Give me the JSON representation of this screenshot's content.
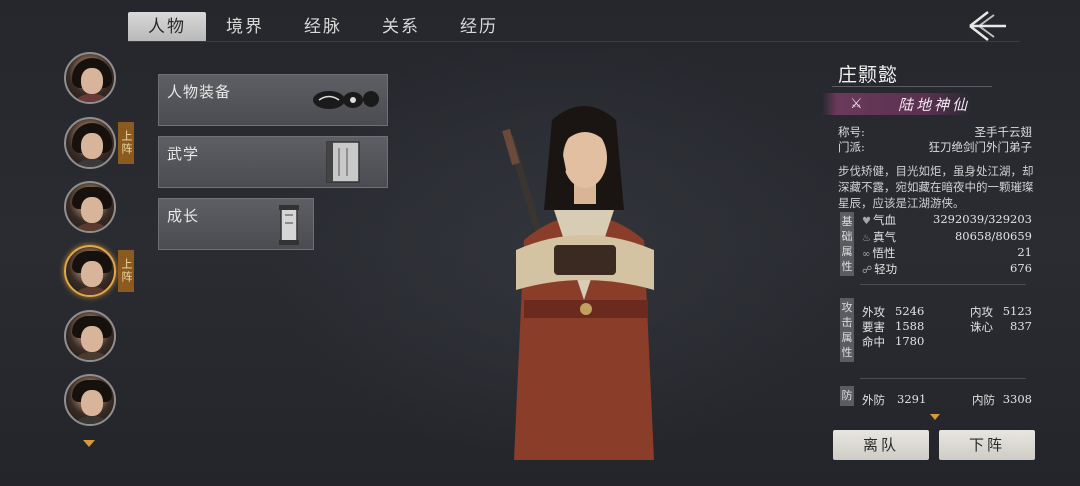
{
  "nav": {
    "tabs": [
      "人物",
      "境界",
      "经脉",
      "关系",
      "经历"
    ],
    "active_tab": 0
  },
  "roster": {
    "badges": [
      "上阵",
      "上阵"
    ],
    "selected_index": 3
  },
  "cards": {
    "equipment": "人物装备",
    "martial": "武学",
    "growth": "成长"
  },
  "character": {
    "name": "庄颢懿",
    "realm": "陆地神仙",
    "title_label": "称号:",
    "title_value": "圣手千云翅",
    "sect_label": "门派:",
    "sect_value": "狂刀绝剑门外门弟子",
    "description": "步伐矫健，目光如炬，虽身处江湖，却深藏不露，宛如藏在暗夜中的一颗璀璨星辰，应该是江湖游侠。"
  },
  "basic": {
    "tag": "基础属性",
    "hp_label": "气血",
    "hp_value": "3292039/329203",
    "mp_label": "真气",
    "mp_value": "80658/80659",
    "wis_label": "悟性",
    "wis_value": "21",
    "agi_label": "轻功",
    "agi_value": "676"
  },
  "attack": {
    "tag": "攻击属性",
    "ext_label": "外攻",
    "ext_value": "5246",
    "int_label": "内攻",
    "int_value": "5123",
    "crit_label": "要害",
    "crit_value": "1588",
    "pierce_label": "诛心",
    "pierce_value": "837",
    "hit_label": "命中",
    "hit_value": "1780"
  },
  "defense": {
    "tag": "防",
    "ext_label": "外防",
    "ext_value": "3291",
    "int_label": "内防",
    "int_value": "3308"
  },
  "buttons": {
    "leave": "离队",
    "retire": "下阵"
  },
  "colors": {
    "accent": "#d59a3a",
    "realm_bg": "#5a3050",
    "badge_bg": "#8a5a1e"
  }
}
